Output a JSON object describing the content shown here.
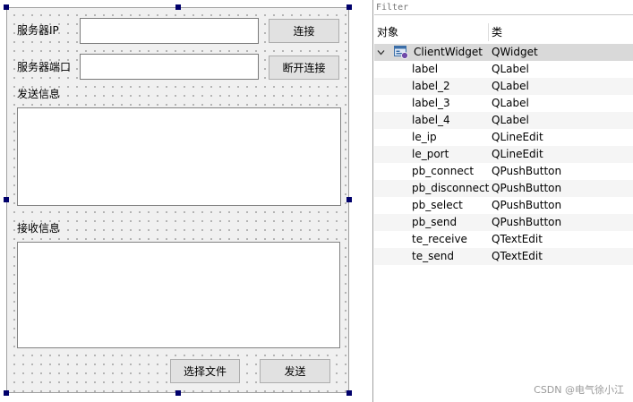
{
  "form": {
    "server_ip_label": "服务器IP",
    "server_port_label": "服务器端口",
    "send_label": "发送信息",
    "receive_label": "接收信息",
    "le_ip_value": "",
    "le_port_value": "",
    "te_send_value": "",
    "te_receive_value": "",
    "connect_button": "连接",
    "disconnect_button": "断开连接",
    "select_file_button": "选择文件",
    "send_button": "发送"
  },
  "inspector": {
    "filter_placeholder": "Filter",
    "filter_value": "",
    "header_object": "对象",
    "header_class": "类",
    "root": {
      "name": "ClientWidget",
      "class": "QWidget"
    },
    "children": [
      {
        "name": "label",
        "class": "QLabel"
      },
      {
        "name": "label_2",
        "class": "QLabel"
      },
      {
        "name": "label_3",
        "class": "QLabel"
      },
      {
        "name": "label_4",
        "class": "QLabel"
      },
      {
        "name": "le_ip",
        "class": "QLineEdit"
      },
      {
        "name": "le_port",
        "class": "QLineEdit"
      },
      {
        "name": "pb_connect",
        "class": "QPushButton"
      },
      {
        "name": "pb_disconnect",
        "class": "QPushButton"
      },
      {
        "name": "pb_select",
        "class": "QPushButton"
      },
      {
        "name": "pb_send",
        "class": "QPushButton"
      },
      {
        "name": "te_receive",
        "class": "QTextEdit"
      },
      {
        "name": "te_send",
        "class": "QTextEdit"
      }
    ]
  },
  "watermark": "CSDN @电气徐小江",
  "colors": {
    "selection_handle": "#00006b",
    "root_row": "#d9d9d9",
    "alt_row": "#f5f5f5"
  }
}
